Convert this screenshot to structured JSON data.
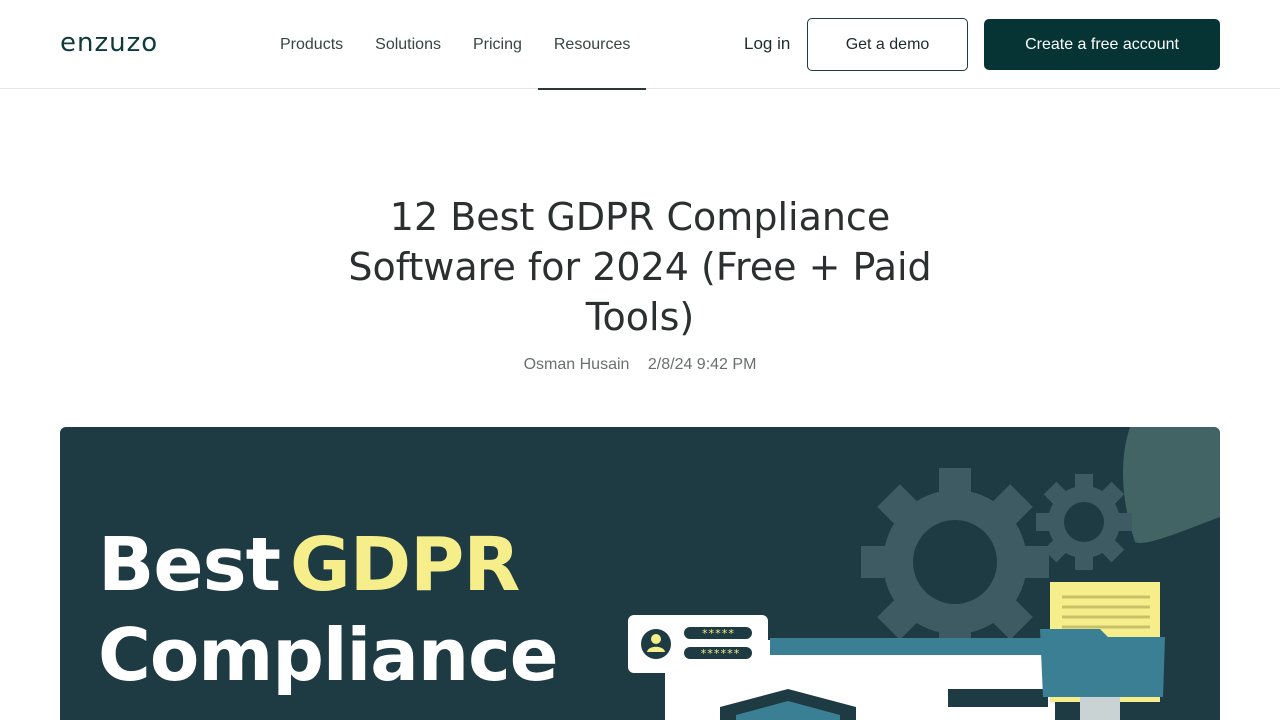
{
  "brand": {
    "logo_text": "enzuzo"
  },
  "nav": {
    "items": [
      {
        "label": "Products"
      },
      {
        "label": "Solutions"
      },
      {
        "label": "Pricing"
      },
      {
        "label": "Resources",
        "active": true
      }
    ]
  },
  "header_actions": {
    "login_label": "Log in",
    "demo_label": "Get a demo",
    "create_label": "Create a free account"
  },
  "article": {
    "title": "12 Best GDPR Compliance Software for 2024 (Free + Paid Tools)",
    "author": "Osman Husain",
    "date": "2/8/24 9:42 PM"
  },
  "hero": {
    "line1_word": "Best",
    "line1_highlight": "GDPR",
    "line2": "Compliance",
    "password_mask_1": "*****",
    "password_mask_2": "******",
    "colors": {
      "background": "#1e3b44",
      "highlight": "#f5ee8a",
      "accent": "#3b7f95"
    }
  },
  "colors": {
    "brand_dark": "#063434",
    "text": "#2b2f2f",
    "muted": "#6b6f6f"
  }
}
